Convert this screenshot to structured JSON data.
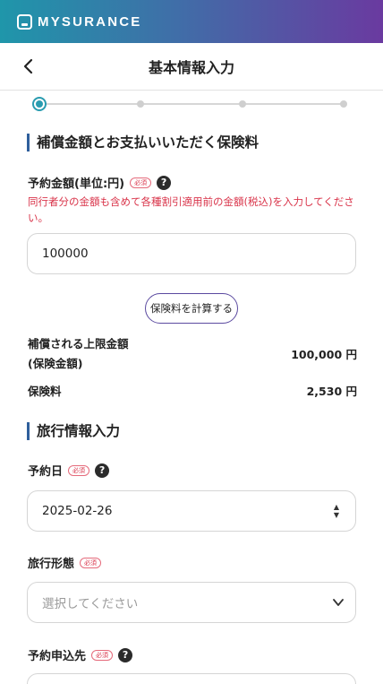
{
  "brand": {
    "name": "MYSURANCE"
  },
  "header": {
    "title": "基本情報入力"
  },
  "stepper": {
    "total_steps": 4,
    "current_step": 1
  },
  "section_compensation": {
    "title": "補償金額とお支払いいただく保険料",
    "amount_label": "予約金額(単位:円)",
    "required_badge": "必須",
    "help_glyph": "?",
    "note": "同行者分の金額も含めて各種割引適用前の金額(税込)を入力してください。",
    "amount_value": "100000",
    "calc_button": "保険料を計算する",
    "limit_label_line1": "補償される上限金額",
    "limit_label_line2": "(保険金額)",
    "limit_value": "100,000 円",
    "premium_label": "保険料",
    "premium_value": "2,530 円"
  },
  "section_travel": {
    "title": "旅行情報入力",
    "date_label": "予約日",
    "required_badge": "必須",
    "help_glyph": "?",
    "date_value": "2025-02-26",
    "type_label": "旅行形態",
    "type_placeholder": "選択してください",
    "agency_label": "予約申込先"
  },
  "icons": {
    "back": "chevron-left-icon",
    "help": "question-circle-icon",
    "select": "chevron-down-icon",
    "spinner": "up-down-spinner-icon"
  },
  "colors": {
    "gradient_start": "#1f96aa",
    "gradient_end": "#6a3aa0",
    "accent": "#2a9cb0",
    "section_bar": "#2f5f9c",
    "required_red": "#d9344a"
  }
}
